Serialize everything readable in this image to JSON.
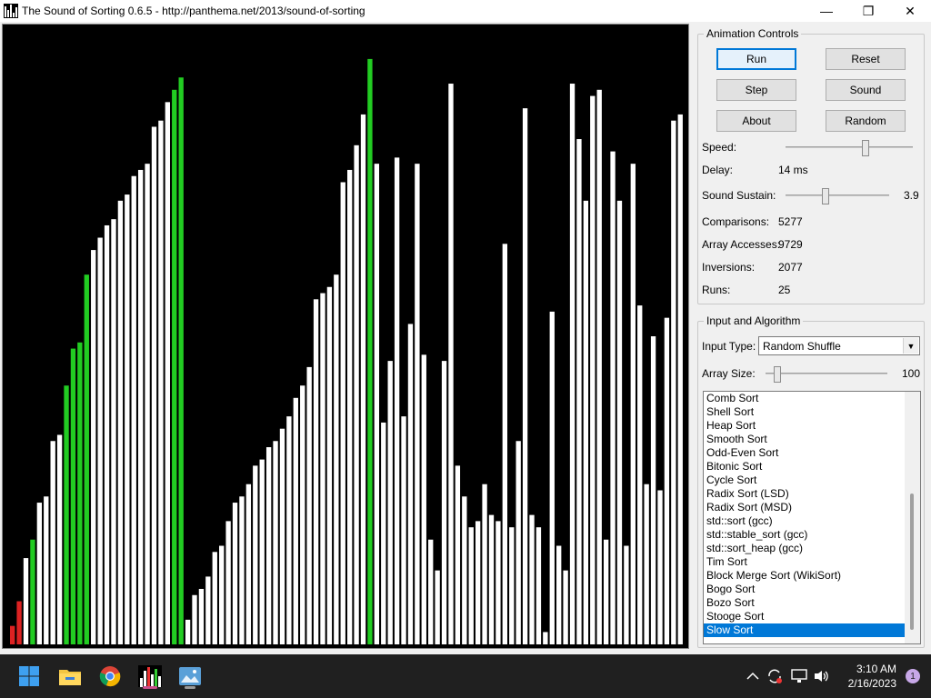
{
  "window": {
    "title": "The Sound of Sorting 0.6.5 - http://panthema.net/2013/sound-of-sorting",
    "minimize": "—",
    "maximize": "❐",
    "close": "✕"
  },
  "animation_controls": {
    "title": "Animation Controls",
    "buttons": {
      "run": "Run",
      "reset": "Reset",
      "step": "Step",
      "sound": "Sound",
      "about": "About",
      "random": "Random"
    },
    "speed_label": "Speed:",
    "speed_level": 0.64,
    "delay_label": "Delay:",
    "delay_value": "14 ms",
    "sustain_label": "Sound Sustain:",
    "sustain_level": 0.38,
    "sustain_value": "3.9",
    "stats": [
      {
        "label": "Comparisons:",
        "value": "5277"
      },
      {
        "label": "Array Accesses:",
        "value": "9729"
      },
      {
        "label": "Inversions:",
        "value": "2077"
      },
      {
        "label": "Runs:",
        "value": "25"
      }
    ]
  },
  "input_algorithm": {
    "title": "Input and Algorithm",
    "input_type_label": "Input Type:",
    "input_type_value": "Random Shuffle",
    "array_size_label": "Array Size:",
    "array_size_value": "100",
    "array_size_level": 0.07,
    "algorithms": [
      "Comb Sort",
      "Shell Sort",
      "Heap Sort",
      "Smooth Sort",
      "Odd-Even Sort",
      "Bitonic Sort",
      "Cycle Sort",
      "Radix Sort (LSD)",
      "Radix Sort (MSD)",
      "std::sort (gcc)",
      "std::stable_sort (gcc)",
      "std::sort_heap (gcc)",
      "Tim Sort",
      "Block Merge Sort (WikiSort)",
      "Bogo Sort",
      "Bozo Sort",
      "Stooge Sort",
      "Slow Sort"
    ],
    "selected_algorithm": "Slow Sort"
  },
  "visualization": {
    "colors": {
      "background": "#000000",
      "normal": "#ffffff",
      "highlight": "#22cc22",
      "access": "#dd2222"
    },
    "bars": [
      {
        "v": 3,
        "c": "access"
      },
      {
        "v": 7,
        "c": "access"
      },
      {
        "v": 14,
        "c": "normal"
      },
      {
        "v": 17,
        "c": "highlight"
      },
      {
        "v": 23,
        "c": "normal"
      },
      {
        "v": 24,
        "c": "normal"
      },
      {
        "v": 33,
        "c": "normal"
      },
      {
        "v": 34,
        "c": "normal"
      },
      {
        "v": 42,
        "c": "highlight"
      },
      {
        "v": 48,
        "c": "highlight"
      },
      {
        "v": 49,
        "c": "highlight"
      },
      {
        "v": 60,
        "c": "highlight"
      },
      {
        "v": 64,
        "c": "normal"
      },
      {
        "v": 66,
        "c": "normal"
      },
      {
        "v": 68,
        "c": "normal"
      },
      {
        "v": 69,
        "c": "normal"
      },
      {
        "v": 72,
        "c": "normal"
      },
      {
        "v": 73,
        "c": "normal"
      },
      {
        "v": 76,
        "c": "normal"
      },
      {
        "v": 77,
        "c": "normal"
      },
      {
        "v": 78,
        "c": "normal"
      },
      {
        "v": 84,
        "c": "normal"
      },
      {
        "v": 85,
        "c": "normal"
      },
      {
        "v": 88,
        "c": "normal"
      },
      {
        "v": 90,
        "c": "highlight"
      },
      {
        "v": 92,
        "c": "highlight"
      },
      {
        "v": 4,
        "c": "normal"
      },
      {
        "v": 8,
        "c": "normal"
      },
      {
        "v": 9,
        "c": "normal"
      },
      {
        "v": 11,
        "c": "normal"
      },
      {
        "v": 15,
        "c": "normal"
      },
      {
        "v": 16,
        "c": "normal"
      },
      {
        "v": 20,
        "c": "normal"
      },
      {
        "v": 23,
        "c": "normal"
      },
      {
        "v": 24,
        "c": "normal"
      },
      {
        "v": 26,
        "c": "normal"
      },
      {
        "v": 29,
        "c": "normal"
      },
      {
        "v": 30,
        "c": "normal"
      },
      {
        "v": 32,
        "c": "normal"
      },
      {
        "v": 33,
        "c": "normal"
      },
      {
        "v": 35,
        "c": "normal"
      },
      {
        "v": 37,
        "c": "normal"
      },
      {
        "v": 40,
        "c": "normal"
      },
      {
        "v": 42,
        "c": "normal"
      },
      {
        "v": 45,
        "c": "normal"
      },
      {
        "v": 56,
        "c": "normal"
      },
      {
        "v": 57,
        "c": "normal"
      },
      {
        "v": 58,
        "c": "normal"
      },
      {
        "v": 60,
        "c": "normal"
      },
      {
        "v": 75,
        "c": "normal"
      },
      {
        "v": 77,
        "c": "normal"
      },
      {
        "v": 81,
        "c": "normal"
      },
      {
        "v": 86,
        "c": "normal"
      },
      {
        "v": 95,
        "c": "highlight"
      },
      {
        "v": 78,
        "c": "normal"
      },
      {
        "v": 36,
        "c": "normal"
      },
      {
        "v": 46,
        "c": "normal"
      },
      {
        "v": 79,
        "c": "normal"
      },
      {
        "v": 37,
        "c": "normal"
      },
      {
        "v": 52,
        "c": "normal"
      },
      {
        "v": 78,
        "c": "normal"
      },
      {
        "v": 47,
        "c": "normal"
      },
      {
        "v": 17,
        "c": "normal"
      },
      {
        "v": 12,
        "c": "normal"
      },
      {
        "v": 46,
        "c": "normal"
      },
      {
        "v": 91,
        "c": "normal"
      },
      {
        "v": 29,
        "c": "normal"
      },
      {
        "v": 24,
        "c": "normal"
      },
      {
        "v": 19,
        "c": "normal"
      },
      {
        "v": 20,
        "c": "normal"
      },
      {
        "v": 26,
        "c": "normal"
      },
      {
        "v": 21,
        "c": "normal"
      },
      {
        "v": 20,
        "c": "normal"
      },
      {
        "v": 65,
        "c": "normal"
      },
      {
        "v": 19,
        "c": "normal"
      },
      {
        "v": 33,
        "c": "normal"
      },
      {
        "v": 87,
        "c": "normal"
      },
      {
        "v": 21,
        "c": "normal"
      },
      {
        "v": 19,
        "c": "normal"
      },
      {
        "v": 2,
        "c": "normal"
      },
      {
        "v": 54,
        "c": "normal"
      },
      {
        "v": 16,
        "c": "normal"
      },
      {
        "v": 12,
        "c": "normal"
      },
      {
        "v": 91,
        "c": "normal"
      },
      {
        "v": 82,
        "c": "normal"
      },
      {
        "v": 72,
        "c": "normal"
      },
      {
        "v": 89,
        "c": "normal"
      },
      {
        "v": 90,
        "c": "normal"
      },
      {
        "v": 17,
        "c": "normal"
      },
      {
        "v": 80,
        "c": "normal"
      },
      {
        "v": 72,
        "c": "normal"
      },
      {
        "v": 16,
        "c": "normal"
      },
      {
        "v": 78,
        "c": "normal"
      },
      {
        "v": 55,
        "c": "normal"
      },
      {
        "v": 26,
        "c": "normal"
      },
      {
        "v": 50,
        "c": "normal"
      },
      {
        "v": 25,
        "c": "normal"
      },
      {
        "v": 53,
        "c": "normal"
      },
      {
        "v": 85,
        "c": "normal"
      },
      {
        "v": 86,
        "c": "normal"
      }
    ]
  },
  "taskbar": {
    "icons": [
      "windows-start-icon",
      "file-explorer-icon",
      "chrome-icon",
      "sound-of-sorting-icon",
      "image-viewer-icon"
    ],
    "tray_icons": [
      "chevron-up-icon",
      "sync-icon",
      "display-icon",
      "volume-icon"
    ],
    "time": "3:10 AM",
    "date": "2/16/2023",
    "notification_count": "1"
  }
}
